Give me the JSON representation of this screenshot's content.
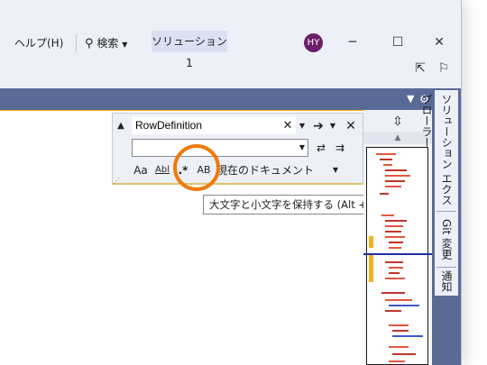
{
  "menu": {
    "help": "ヘルプ(H)",
    "search": "検索",
    "solution": "ソリューション1",
    "avatar": "HY"
  },
  "findbar": {
    "find_value": "RowDefinition",
    "replace_value": "",
    "match_case": "Aa",
    "whole_word": "Abl",
    "regex": ".*",
    "preserve_case": "AB",
    "scope": "現在のドキュメント"
  },
  "tooltip": "大文字と小文字を保持する (Alt + V)",
  "side_tabs": [
    "ソリューション エクスプローラー",
    "Git 変更",
    "通知"
  ],
  "colors": {
    "accent": "#5a6a96",
    "highlight": "#f07a0c",
    "avatar": "#6b1f6a"
  }
}
